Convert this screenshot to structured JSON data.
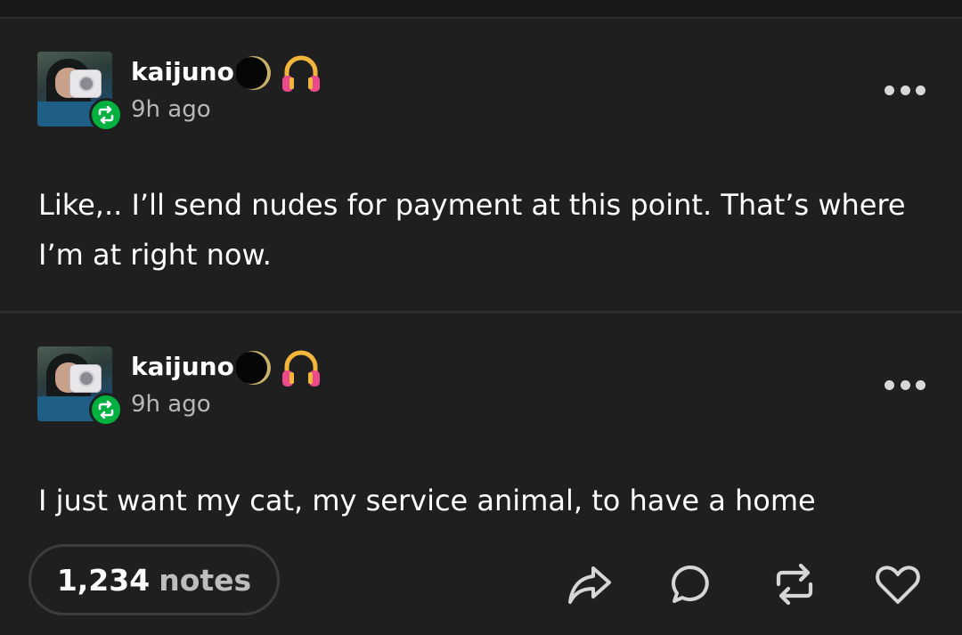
{
  "posts": [
    {
      "username": "kaijuno",
      "time": "9h ago",
      "text": "Like,.. I’ll send nudes for payment at this point. That’s where I’m at right now.",
      "icons": [
        "avatar-photo",
        "reblog-icon",
        "moon-icon",
        "headphones-emoji",
        "more-icon"
      ]
    },
    {
      "username": "kaijuno",
      "time": "9h ago",
      "text": "I just want my cat, my service animal, to have a home",
      "icons": [
        "avatar-photo",
        "reblog-icon",
        "moon-icon",
        "headphones-emoji",
        "more-icon"
      ]
    }
  ],
  "footer": {
    "notes_count": "1,234",
    "notes_label": "notes",
    "actions": [
      "share-icon",
      "reply-icon",
      "reblog-icon",
      "like-icon"
    ]
  },
  "colors": {
    "background": "#1f1f1f",
    "reblog_green": "#00b140",
    "text": "#ffffff",
    "muted": "#b8b8b8"
  }
}
